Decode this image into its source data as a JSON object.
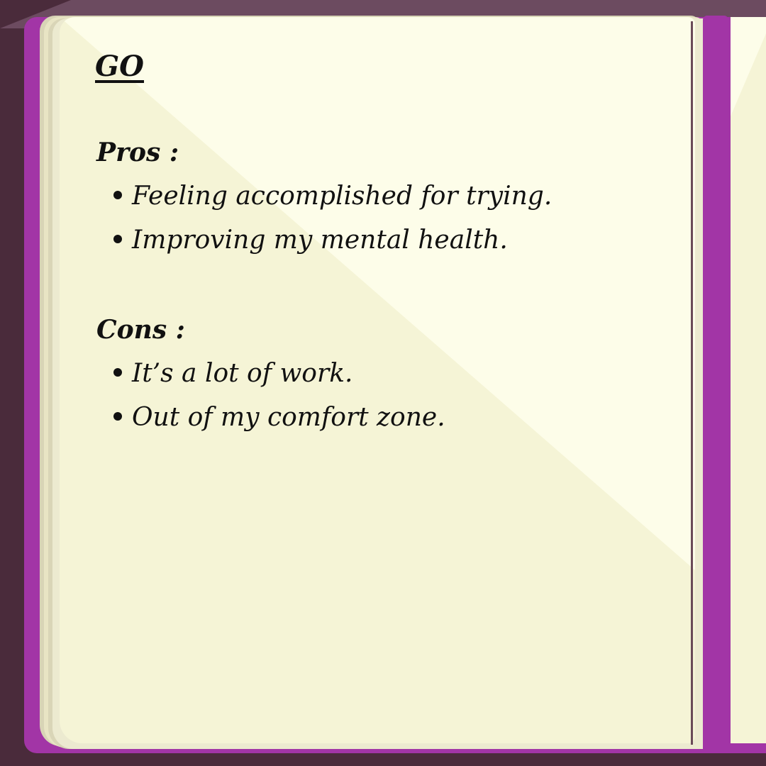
{
  "heading": "GO",
  "pros": {
    "label": "Pros :",
    "items": [
      "Feeling accomplished for trying.",
      "Improving my mental health."
    ]
  },
  "cons": {
    "label": "Cons :",
    "items": [
      "It’s a lot of work.",
      "Out of my comfort zone."
    ]
  },
  "colors": {
    "cover": "#a235a6",
    "background": "#4a2b3b",
    "page": "#f5f4d6",
    "page_highlight": "#fdfde9",
    "ink": "#111111"
  }
}
